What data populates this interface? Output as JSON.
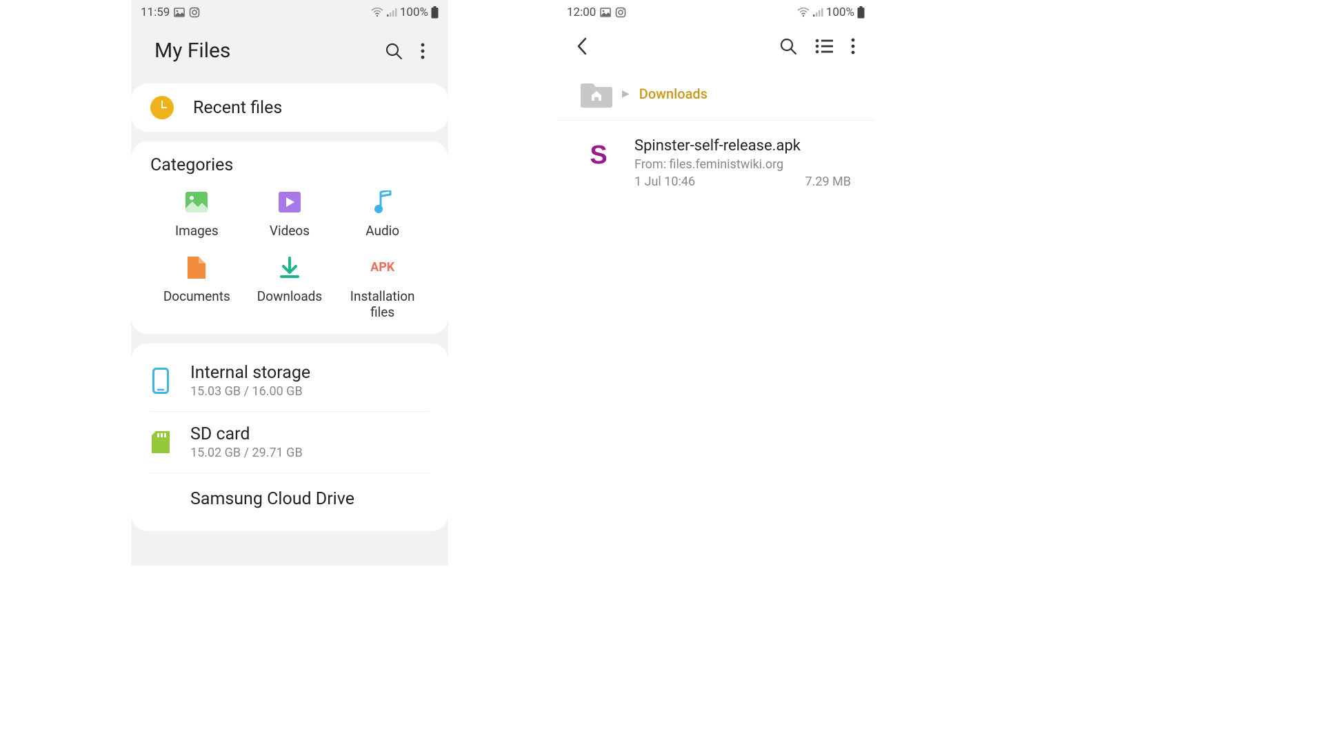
{
  "left": {
    "status": {
      "time": "11:59",
      "battery": "100%"
    },
    "title": "My Files",
    "recent_label": "Recent files",
    "categories_title": "Categories",
    "categories": [
      {
        "label": "Images"
      },
      {
        "label": "Videos"
      },
      {
        "label": "Audio"
      },
      {
        "label": "Documents"
      },
      {
        "label": "Downloads"
      },
      {
        "label": "Installation\nfiles"
      }
    ],
    "storage": [
      {
        "title": "Internal storage",
        "sub": "15.03 GB / 16.00 GB"
      },
      {
        "title": "SD card",
        "sub": "15.02 GB / 29.71 GB"
      },
      {
        "title": "Samsung Cloud Drive",
        "sub": ""
      }
    ]
  },
  "right": {
    "status": {
      "time": "12:00",
      "battery": "100%"
    },
    "breadcrumb_current": "Downloads",
    "file": {
      "letter": "S",
      "name": "Spinster-self-release.apk",
      "from": "From: files.feministwiki.org",
      "date": "1 Jul 10:46",
      "size": "7.29 MB"
    }
  }
}
